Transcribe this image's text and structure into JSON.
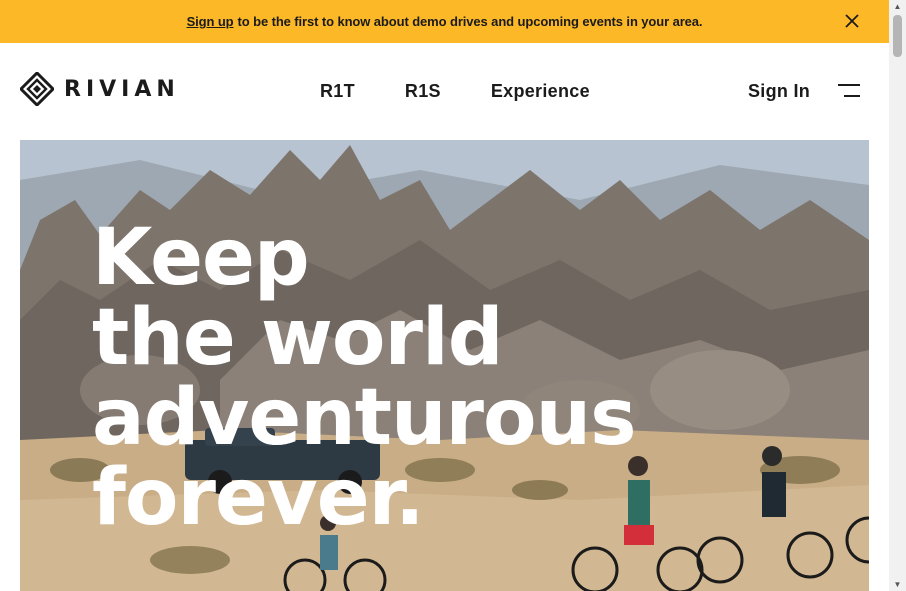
{
  "banner": {
    "link_text": "Sign up",
    "message": "to be the first to know about demo drives and upcoming events in your area.",
    "close_icon": "close-icon",
    "background": "#fdb827"
  },
  "header": {
    "logo_text": "RIVIAN",
    "nav": [
      {
        "label": "R1T"
      },
      {
        "label": "R1S"
      },
      {
        "label": "Experience"
      }
    ],
    "sign_in": "Sign In",
    "menu_icon": "hamburger-menu-icon"
  },
  "hero": {
    "headline_lines": [
      "Keep",
      "the world",
      "adventurous",
      "forever."
    ]
  },
  "scrollbar": {
    "up_icon": "▲",
    "down_icon": "▼"
  }
}
